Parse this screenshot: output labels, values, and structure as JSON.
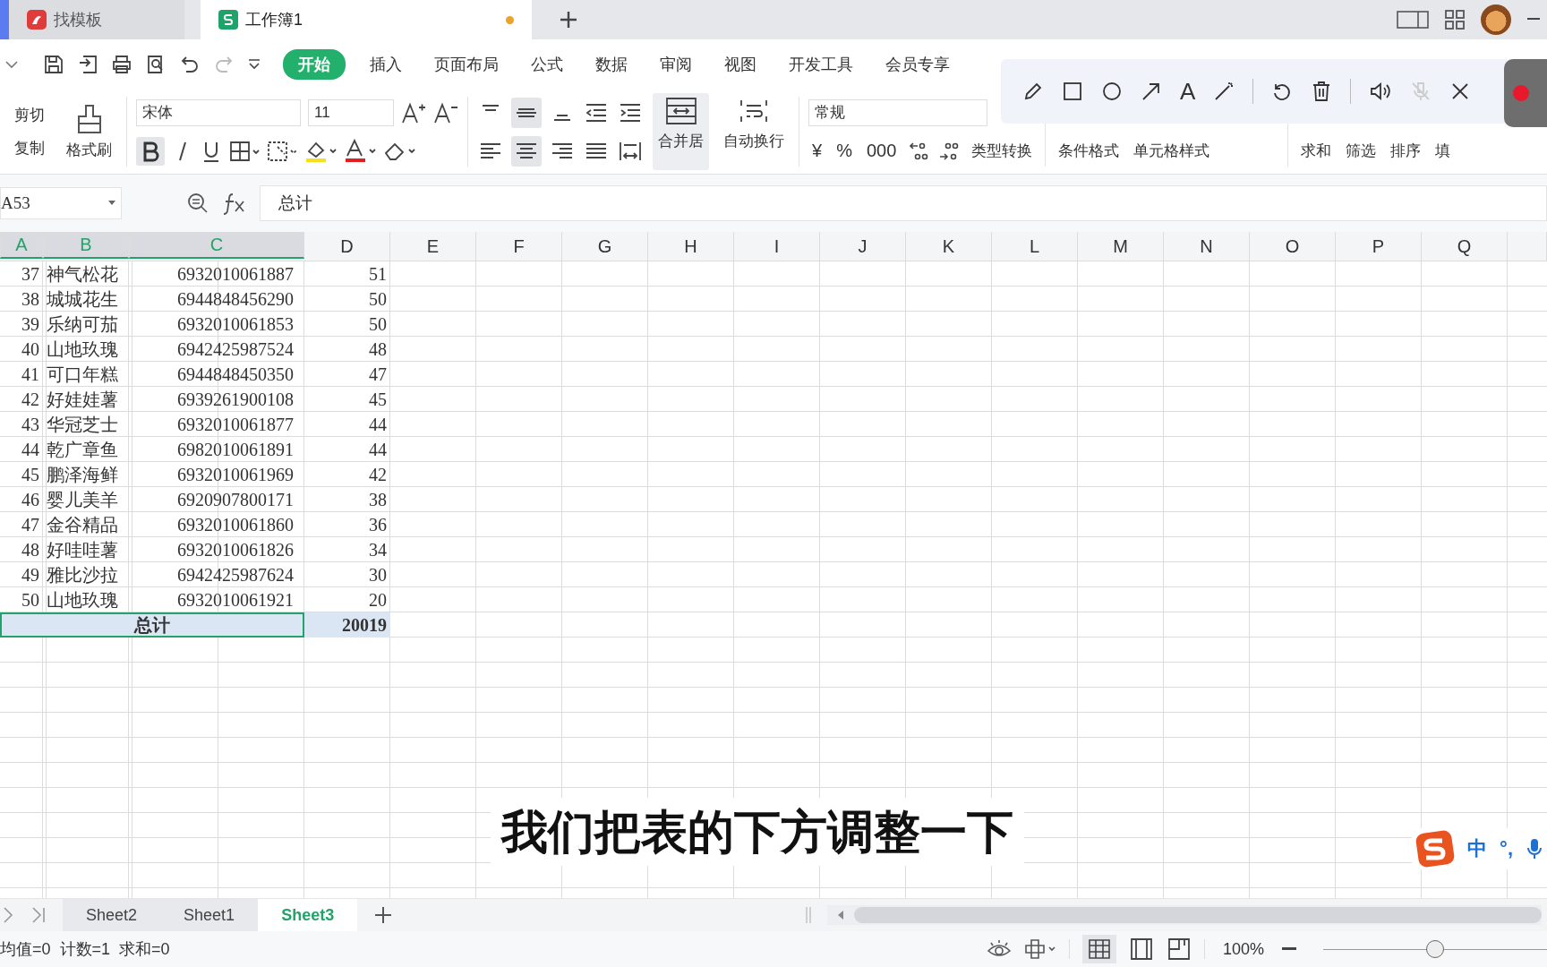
{
  "tabs": [
    {
      "label": "找模板",
      "selected": false,
      "kind": "template",
      "unsaved": false
    },
    {
      "label": "工作簿1",
      "selected": true,
      "kind": "workbook",
      "unsaved": true
    }
  ],
  "menu": [
    {
      "label": "开始",
      "selected": true
    },
    {
      "label": "插入",
      "selected": false
    },
    {
      "label": "页面布局",
      "selected": false
    },
    {
      "label": "公式",
      "selected": false
    },
    {
      "label": "数据",
      "selected": false
    },
    {
      "label": "审阅",
      "selected": false
    },
    {
      "label": "视图",
      "selected": false
    },
    {
      "label": "开发工具",
      "selected": false
    },
    {
      "label": "会员专享",
      "selected": false
    }
  ],
  "ribbon": {
    "cut": "剪切",
    "copy": "复制",
    "format_painter": "格式刷",
    "font": "宋体",
    "size": "11",
    "merge": "合并居",
    "wrap": "自动换行",
    "number_format": "常规",
    "currency": "¥",
    "percent": "%",
    "thousands": "000",
    "type_convert": "类型转换",
    "conditional": "条件格式",
    "cell_style": "单元格样式",
    "sum": "求和",
    "filter": "筛选",
    "sort": "排序",
    "fill": "填"
  },
  "annotation_toolbar": {
    "text_tool": "A"
  },
  "name_box": "A53",
  "formula": "总计",
  "columns": [
    {
      "label": "A",
      "selected": true
    },
    {
      "label": "B",
      "selected": true
    },
    {
      "label": "C",
      "selected": true
    },
    {
      "label": "D",
      "selected": false
    },
    {
      "label": "E",
      "selected": false
    },
    {
      "label": "F",
      "selected": false
    },
    {
      "label": "G",
      "selected": false
    },
    {
      "label": "H",
      "selected": false
    },
    {
      "label": "I",
      "selected": false
    },
    {
      "label": "J",
      "selected": false
    },
    {
      "label": "K",
      "selected": false
    },
    {
      "label": "L",
      "selected": false
    },
    {
      "label": "M",
      "selected": false
    },
    {
      "label": "N",
      "selected": false
    },
    {
      "label": "O",
      "selected": false
    },
    {
      "label": "P",
      "selected": false
    },
    {
      "label": "Q",
      "selected": false
    }
  ],
  "rows": [
    {
      "a": "37",
      "b": "神气松花",
      "c": "6932010061887",
      "d": "51"
    },
    {
      "a": "38",
      "b": "城城花生",
      "c": "6944848456290",
      "d": "50"
    },
    {
      "a": "39",
      "b": "乐纳可茄",
      "c": "6932010061853",
      "d": "50"
    },
    {
      "a": "40",
      "b": "山地玖瑰",
      "c": "6942425987524",
      "d": "48"
    },
    {
      "a": "41",
      "b": "可口年糕",
      "c": "6944848450350",
      "d": "47"
    },
    {
      "a": "42",
      "b": "好娃娃薯",
      "c": "6939261900108",
      "d": "45"
    },
    {
      "a": "43",
      "b": "华冠芝士",
      "c": "6932010061877",
      "d": "44"
    },
    {
      "a": "44",
      "b": "乾广章鱼",
      "c": "6982010061891",
      "d": "44"
    },
    {
      "a": "45",
      "b": "鹏泽海鲜",
      "c": "6932010061969",
      "d": "42"
    },
    {
      "a": "46",
      "b": "婴儿美羊",
      "c": "6920907800171",
      "d": "38"
    },
    {
      "a": "47",
      "b": "金谷精品",
      "c": "6932010061860",
      "d": "36"
    },
    {
      "a": "48",
      "b": "好哇哇薯",
      "c": "6932010061826",
      "d": "34"
    },
    {
      "a": "49",
      "b": "雅比沙拉",
      "c": "6942425987624",
      "d": "30"
    },
    {
      "a": "50",
      "b": "山地玖瑰",
      "c": "6932010061921",
      "d": "20"
    }
  ],
  "total": {
    "label": "总计",
    "value": "20019",
    "selected": true
  },
  "sheets": [
    {
      "label": "Sheet2",
      "selected": false
    },
    {
      "label": "Sheet1",
      "selected": false
    },
    {
      "label": "Sheet3",
      "selected": true
    }
  ],
  "status": [
    "均值=0",
    "计数=1",
    "求和=0"
  ],
  "zoom": {
    "value": "100%",
    "level": 0.5
  },
  "ime": {
    "mode": "中",
    "punct": "°,"
  },
  "subtitle": "我们把表的下方调整一下"
}
